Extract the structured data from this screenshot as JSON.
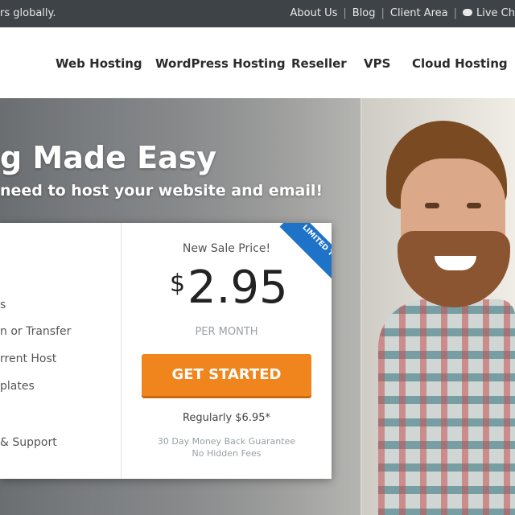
{
  "topbar": {
    "tagline": "rs globally.",
    "links": [
      "About Us",
      "Blog",
      "Client Area"
    ],
    "chat_label": "Live Ch",
    "chat_icon": "chat-bubble-icon"
  },
  "nav": {
    "items": [
      "Web Hosting",
      "WordPress Hosting",
      "Reseller",
      "VPS",
      "Cloud Hosting"
    ]
  },
  "hero": {
    "title": "g Made Easy",
    "subtitle": "need to host your website and email!"
  },
  "card": {
    "features": [
      "s",
      "n or Transfer",
      "rrent Host",
      "plates",
      "& Support"
    ],
    "ribbon": "LIMITED TIME",
    "sale_label": "New Sale Price!",
    "currency": "$",
    "price": "2.95",
    "per": "PER MONTH",
    "cta": "GET STARTED",
    "regular": "Regularly $6.95*",
    "guarantee": "30 Day Money Back Guarantee",
    "no_fees": "No Hidden Fees"
  },
  "colors": {
    "cta": "#f0851e",
    "ribbon": "#1e73c8",
    "topbar": "#3d4347"
  }
}
